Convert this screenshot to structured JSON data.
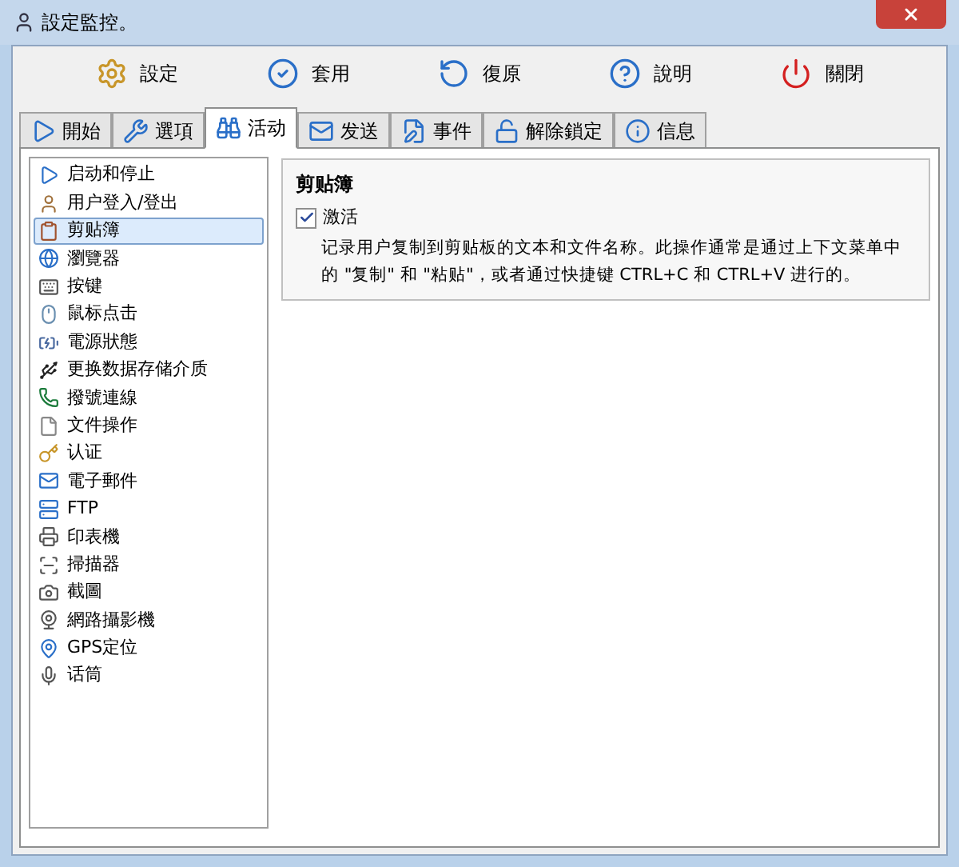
{
  "window": {
    "title": "設定監控。"
  },
  "toolbar": [
    {
      "label": "設定"
    },
    {
      "label": "套用"
    },
    {
      "label": "復原"
    },
    {
      "label": "說明"
    },
    {
      "label": "關閉"
    }
  ],
  "tabs": [
    {
      "label": "開始",
      "selected": false
    },
    {
      "label": "選項",
      "selected": false
    },
    {
      "label": "活动",
      "selected": true
    },
    {
      "label": "发送",
      "selected": false
    },
    {
      "label": "事件",
      "selected": false
    },
    {
      "label": "解除鎖定",
      "selected": false
    },
    {
      "label": "信息",
      "selected": false
    }
  ],
  "sidebar": {
    "items": [
      {
        "label": "启动和停止",
        "selected": false
      },
      {
        "label": "用户登入/登出",
        "selected": false
      },
      {
        "label": "剪贴簿",
        "selected": true
      },
      {
        "label": "瀏覽器",
        "selected": false
      },
      {
        "label": "按键",
        "selected": false
      },
      {
        "label": "鼠标点击",
        "selected": false
      },
      {
        "label": "電源狀態",
        "selected": false
      },
      {
        "label": "更换数据存储介质",
        "selected": false
      },
      {
        "label": "撥號連線",
        "selected": false
      },
      {
        "label": "文件操作",
        "selected": false
      },
      {
        "label": "认证",
        "selected": false
      },
      {
        "label": "電子郵件",
        "selected": false
      },
      {
        "label": "FTP",
        "selected": false
      },
      {
        "label": "印表機",
        "selected": false
      },
      {
        "label": "掃描器",
        "selected": false
      },
      {
        "label": "截圖",
        "selected": false
      },
      {
        "label": "網路攝影機",
        "selected": false
      },
      {
        "label": "GPS定位",
        "selected": false
      },
      {
        "label": "话筒",
        "selected": false
      }
    ]
  },
  "group": {
    "title": "剪贴簿",
    "checkbox": {
      "label": "激活",
      "checked": true
    },
    "description": "记录用户复制到剪贴板的文本和文件名称。此操作通常是通过上下文菜单中的 \"复制\" 和 \"粘贴\"，或者通过快捷键 CTRL+C 和 CTRL+V 进行的。"
  }
}
